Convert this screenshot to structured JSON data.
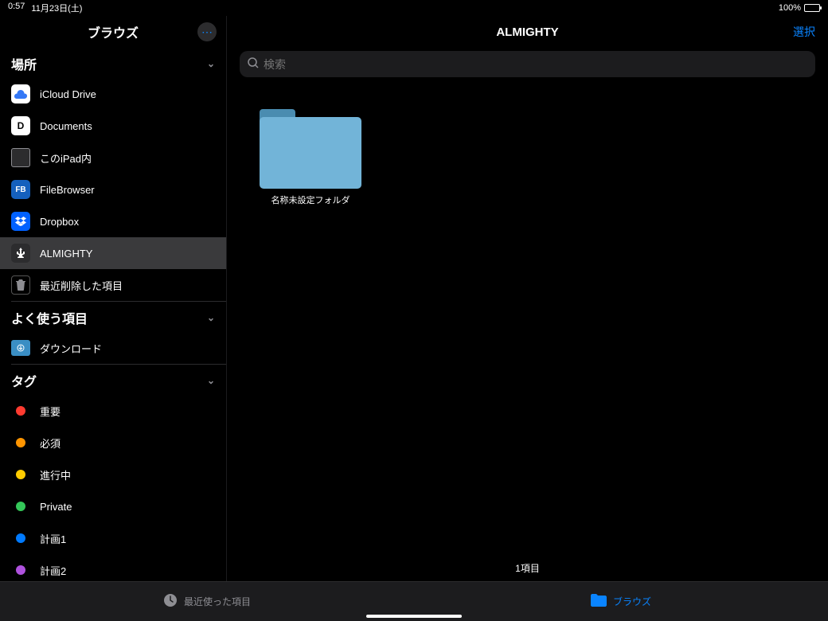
{
  "status": {
    "time": "0:57",
    "date": "11月23日(土)",
    "battery": "100%"
  },
  "sidebar": {
    "title": "ブラウズ",
    "sections": {
      "locations": {
        "header": "場所",
        "items": [
          {
            "label": "iCloud Drive"
          },
          {
            "label": "Documents"
          },
          {
            "label": "このiPad内"
          },
          {
            "label": "FileBrowser"
          },
          {
            "label": "Dropbox"
          },
          {
            "label": "ALMIGHTY"
          },
          {
            "label": "最近削除した項目"
          }
        ]
      },
      "favorites": {
        "header": "よく使う項目",
        "items": [
          {
            "label": "ダウンロード"
          }
        ]
      },
      "tags": {
        "header": "タグ",
        "items": [
          {
            "label": "重要",
            "color": "#ff3b30"
          },
          {
            "label": "必須",
            "color": "#ff9500"
          },
          {
            "label": "進行中",
            "color": "#ffcc00"
          },
          {
            "label": "Private",
            "color": "#34c759"
          },
          {
            "label": "計画1",
            "color": "#007aff"
          },
          {
            "label": "計画2",
            "color": "#af52de"
          }
        ]
      }
    }
  },
  "main": {
    "title": "ALMIGHTY",
    "select_label": "選択",
    "search_placeholder": "検索",
    "folders": [
      {
        "label": "名称未設定フォルダ"
      }
    ],
    "item_count": "1項目"
  },
  "bottombar": {
    "recent": "最近使った項目",
    "browse": "ブラウズ"
  }
}
